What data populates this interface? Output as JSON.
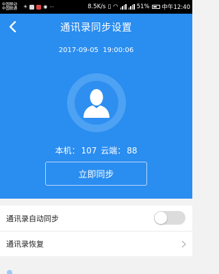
{
  "status_bar": {
    "carrier_top": "中国移动",
    "carrier_bottom": "中国联通",
    "network_speed": "8.5K/s",
    "battery": "51%",
    "time": "中午12:40",
    "colors": {
      "background": "#000000",
      "text": "#ffffff"
    }
  },
  "header": {
    "title": "通讯录同步设置",
    "back_icon": "chevron-left-icon"
  },
  "sync_info": {
    "last_sync_time": "2017-09-05  19:00:06",
    "avatar_icon": "user-silhouette-icon",
    "local_label": "本机：",
    "local_count": "107",
    "cloud_label": "云端：",
    "cloud_count": "88",
    "sync_button_label": "立即同步"
  },
  "settings": {
    "auto_sync_label": "通讯录自动同步",
    "auto_sync_enabled": false,
    "restore_label": "通讯录恢复",
    "restore_icon": "chevron-right-icon"
  },
  "colors": {
    "primary": "#2a8df0",
    "avatar_ring": "#4ea2f3",
    "toggle_off": "#dcdcdc",
    "page_background": "#f2f2f2"
  }
}
